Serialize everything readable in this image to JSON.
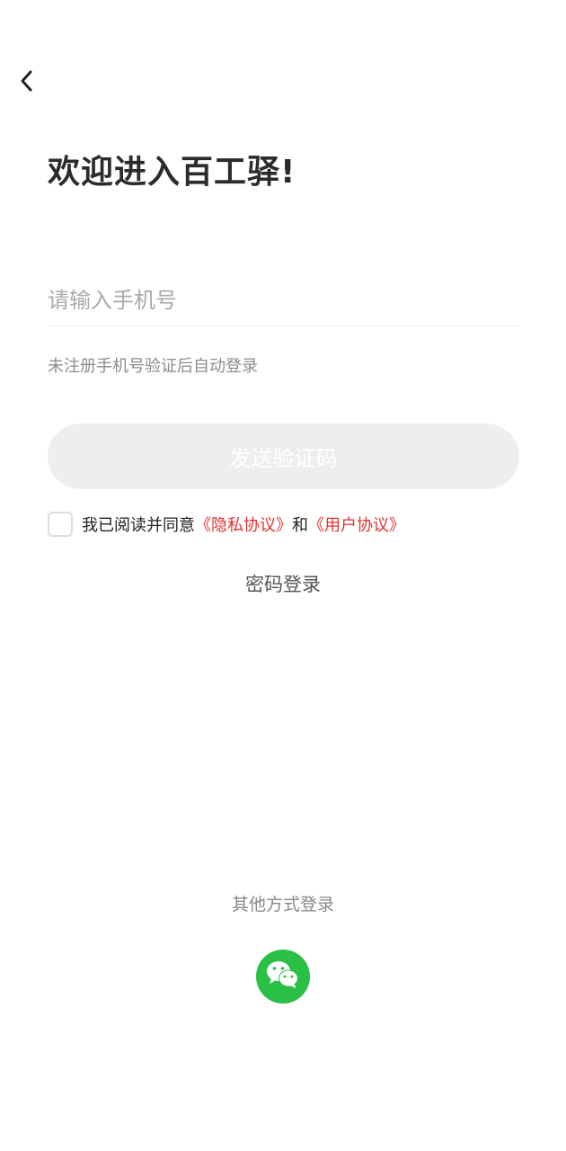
{
  "header": {
    "back_icon": "chevron-left-icon"
  },
  "title": "欢迎进入百工驿!",
  "phone": {
    "placeholder": "请输入手机号",
    "value": ""
  },
  "hint": "未注册手机号验证后自动登录",
  "send_button": {
    "label": "发送验证码"
  },
  "agreement": {
    "checked": false,
    "prefix": "我已阅读并同意",
    "privacy_link": "《隐私协议》",
    "conjunction": "和",
    "user_link": "《用户协议》"
  },
  "password_login": "密码登录",
  "other_login": {
    "label": "其他方式登录",
    "wechat_icon": "wechat-icon"
  },
  "colors": {
    "link": "#e0332f",
    "wechat": "#2ac045",
    "send_button_bg": "#eeeeee"
  }
}
